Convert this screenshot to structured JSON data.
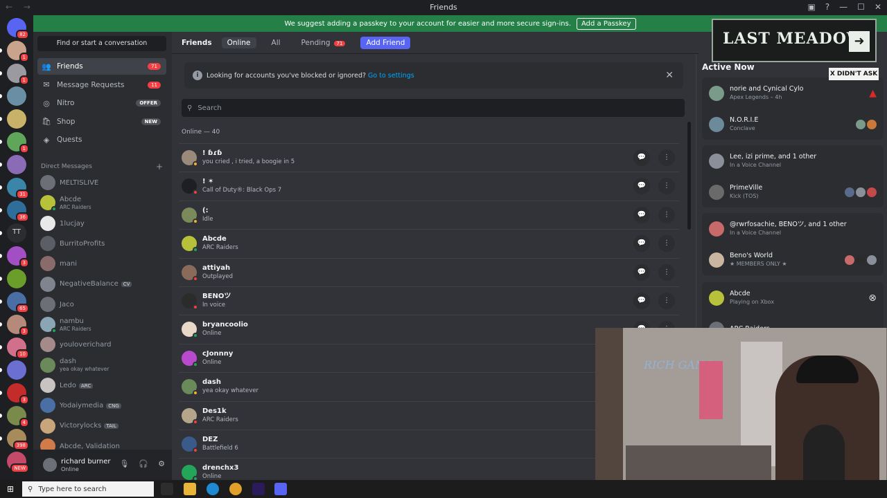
{
  "window": {
    "title": "Friends",
    "nav": "← →"
  },
  "banner": {
    "text": "We suggest adding a passkey to your account for easier and more secure sign-ins.",
    "button": "Add a Passkey"
  },
  "rail": {
    "servers": [
      {
        "color": "#5865f2",
        "badge": "82"
      },
      {
        "color": "#c9a38c",
        "badge": "1"
      },
      {
        "color": "#9a9aa0",
        "badge": "1"
      },
      {
        "color": "#6a8fa5",
        "badge": ""
      },
      {
        "color": "#c8b26a",
        "badge": ""
      },
      {
        "color": "#5fa55a",
        "badge": "1"
      },
      {
        "color": "#8a6bb5",
        "badge": ""
      },
      {
        "color": "#3a85a8",
        "badge": "31"
      },
      {
        "color": "#2f6d9a",
        "badge": "36"
      },
      {
        "color": "#2b2d31",
        "badge": "",
        "text": "TT"
      },
      {
        "color": "#a24fc4",
        "badge": "3"
      },
      {
        "color": "#6b9d2a",
        "badge": ""
      },
      {
        "color": "#4a6fa5",
        "badge": "65"
      },
      {
        "color": "#b58a7a",
        "badge": "3"
      },
      {
        "color": "#d1708a",
        "badge": "10"
      },
      {
        "color": "#6a6fd1",
        "badge": ""
      },
      {
        "color": "#c42b2b",
        "badge": "3"
      },
      {
        "color": "#7a8a4a",
        "badge": "4"
      },
      {
        "color": "#a88b5a",
        "badge": "398"
      },
      {
        "color": "#c44a6a",
        "badge": "NEW"
      }
    ]
  },
  "sidebar": {
    "find_placeholder": "Find or start a conversation",
    "nav": [
      {
        "label": "Friends",
        "icon": "👥",
        "pill": "71",
        "pill_style": "red",
        "active": true
      },
      {
        "label": "Message Requests",
        "icon": "✉",
        "pill": "11",
        "pill_style": "red"
      },
      {
        "label": "Nitro",
        "icon": "◎",
        "pill": "OFFER",
        "pill_style": "grey"
      },
      {
        "label": "Shop",
        "icon": "🛍",
        "pill": "NEW",
        "pill_style": "grey"
      },
      {
        "label": "Quests",
        "icon": "◈",
        "pill": ""
      }
    ],
    "dm_header": "Direct Messages",
    "dms": [
      {
        "name": "MELTISLIVE",
        "sub": "",
        "tag": "",
        "color": "#6d6f78",
        "status": ""
      },
      {
        "name": "Abcde",
        "sub": "ARC Raiders",
        "tag": "",
        "color": "#b7c23a",
        "status": "#23a55a"
      },
      {
        "name": "1lucjay",
        "sub": "",
        "tag": "",
        "color": "#e8e8e8",
        "status": ""
      },
      {
        "name": "BurritoProfits",
        "sub": "",
        "tag": "",
        "color": "#5c5e66",
        "status": ""
      },
      {
        "name": "mani",
        "sub": "",
        "tag": "",
        "color": "#8a6b6b",
        "status": ""
      },
      {
        "name": "NegativeBalance",
        "sub": "",
        "tag": "CV",
        "color": "#80848e",
        "status": ""
      },
      {
        "name": "Jaco",
        "sub": "",
        "tag": "",
        "color": "#6d6f78",
        "status": ""
      },
      {
        "name": "nambu",
        "sub": "ARC Raiders",
        "tag": "",
        "color": "#8aa6b5",
        "status": "#23a55a"
      },
      {
        "name": "youloverichard",
        "sub": "",
        "tag": "",
        "color": "#a58a8a",
        "status": ""
      },
      {
        "name": "dash",
        "sub": "yea okay whatever",
        "tag": "",
        "color": "#6a8a5a",
        "status": ""
      },
      {
        "name": "Ledo",
        "sub": "",
        "tag": "ARC",
        "color": "#c9c4c1",
        "status": ""
      },
      {
        "name": "Yodaiymedia",
        "sub": "",
        "tag": "CNG",
        "color": "#4a6fa5",
        "status": ""
      },
      {
        "name": "Victorylocks",
        "sub": "",
        "tag": "TAIL",
        "color": "#c8a57a",
        "status": ""
      },
      {
        "name": "Abcde, Validation",
        "sub": "",
        "tag": "",
        "color": "#d17a4a",
        "status": ""
      }
    ],
    "user": {
      "name": "richard burner",
      "status": "Online"
    }
  },
  "topbar": {
    "title": "Friends",
    "tabs": [
      "Online",
      "All",
      "Pending"
    ],
    "pending_count": "71",
    "add_friend": "Add Friend"
  },
  "infobar": {
    "text": "Looking for accounts you've blocked or ignored?",
    "link": "Go to settings"
  },
  "search": {
    "placeholder": "Search"
  },
  "online_count": "Online — 40",
  "friends": [
    {
      "name": "! ɓɾɓ",
      "sub": "you cried , i tried, a boogie in 5",
      "color": "#9a8a7a",
      "status": "#f0b232"
    },
    {
      "name": "! ✶",
      "sub": "Call of Duty®: Black Ops 7",
      "color": "#1e1f22",
      "status": "#f23f43"
    },
    {
      "name": "(:",
      "sub": "Idle",
      "color": "#7a8a5a",
      "status": "#f0b232"
    },
    {
      "name": "Abcde",
      "sub": "ARC Raiders",
      "color": "#b7c23a",
      "status": "#23a55a"
    },
    {
      "name": "attiyah",
      "sub": "Outplayed",
      "color": "#8a6b5a",
      "status": "#f23f43"
    },
    {
      "name": "BENOツ",
      "sub": "In voice",
      "color": "#2b2b2b",
      "status": "#f23f43"
    },
    {
      "name": "bryancoolio",
      "sub": "Online",
      "color": "#e8d8c8",
      "status": "#23a55a"
    },
    {
      "name": "cJonnny",
      "sub": "Online",
      "color": "#b94acd",
      "status": "#23a55a"
    },
    {
      "name": "dash",
      "sub": "yea okay whatever",
      "color": "#6a8a5a",
      "status": "#f0b232"
    },
    {
      "name": "Des1k",
      "sub": "ARC Raiders",
      "color": "#b5a58a",
      "status": "#f23f43"
    },
    {
      "name": "DEZ",
      "sub": "Battlefield 6",
      "color": "#3a5a8a",
      "status": "#f23f43"
    },
    {
      "name": "drenchx3",
      "sub": "Online",
      "color": "#23a55a",
      "status": "#23a55a"
    }
  ],
  "active_now": {
    "title": "Active Now",
    "cards": [
      {
        "rows": [
          {
            "name": "norie and Cynical Cylo",
            "sub": "Apex Legends – 4h",
            "color": "#7a9a8a",
            "icon": "▲",
            "icon_color": "#da292a"
          },
          {
            "name": "N.O.R.I.E",
            "sub": "Conclave",
            "color": "#6d8a9a",
            "avatars": [
              "#7a9a8a",
              "#c8783a"
            ]
          }
        ]
      },
      {
        "rows": [
          {
            "name": "Lee, izi prime, and 1 other",
            "sub": "In a Voice Channel",
            "color": "#8a8f9a"
          },
          {
            "name": "PrimeVille",
            "sub": "Kick (TOS)",
            "color": "#6a6a6a",
            "avatars": [
              "#5a6a8a",
              "#8a8f9a",
              "#c44a4a"
            ]
          }
        ]
      },
      {
        "rows": [
          {
            "name": "@rwrfosachie, BENOツ, and 1 other",
            "sub": "In a Voice Channel",
            "color": "#c86a6a"
          },
          {
            "name": "Beno's World",
            "sub": "★ MEMBERS ONLY ★",
            "color": "#c9b5a0",
            "avatars": [
              "#c86a6a",
              "#2b2b2b",
              "#8a8f9a"
            ]
          }
        ]
      },
      {
        "rows": [
          {
            "name": "Abcde",
            "sub": "Playing on Xbox",
            "color": "#b7c23a",
            "icon": "⊗",
            "icon_color": "#dbdee1"
          },
          {
            "name": "ARC Raiders",
            "sub": "",
            "color": "#6d6f78"
          }
        ]
      }
    ]
  },
  "overlays": {
    "meadow": "LAST MEADOW",
    "didnt_ask": "X DIDN'T ASK",
    "webcam_sign": "RICH GANG"
  },
  "taskbar": {
    "search_placeholder": "Type here to search"
  }
}
